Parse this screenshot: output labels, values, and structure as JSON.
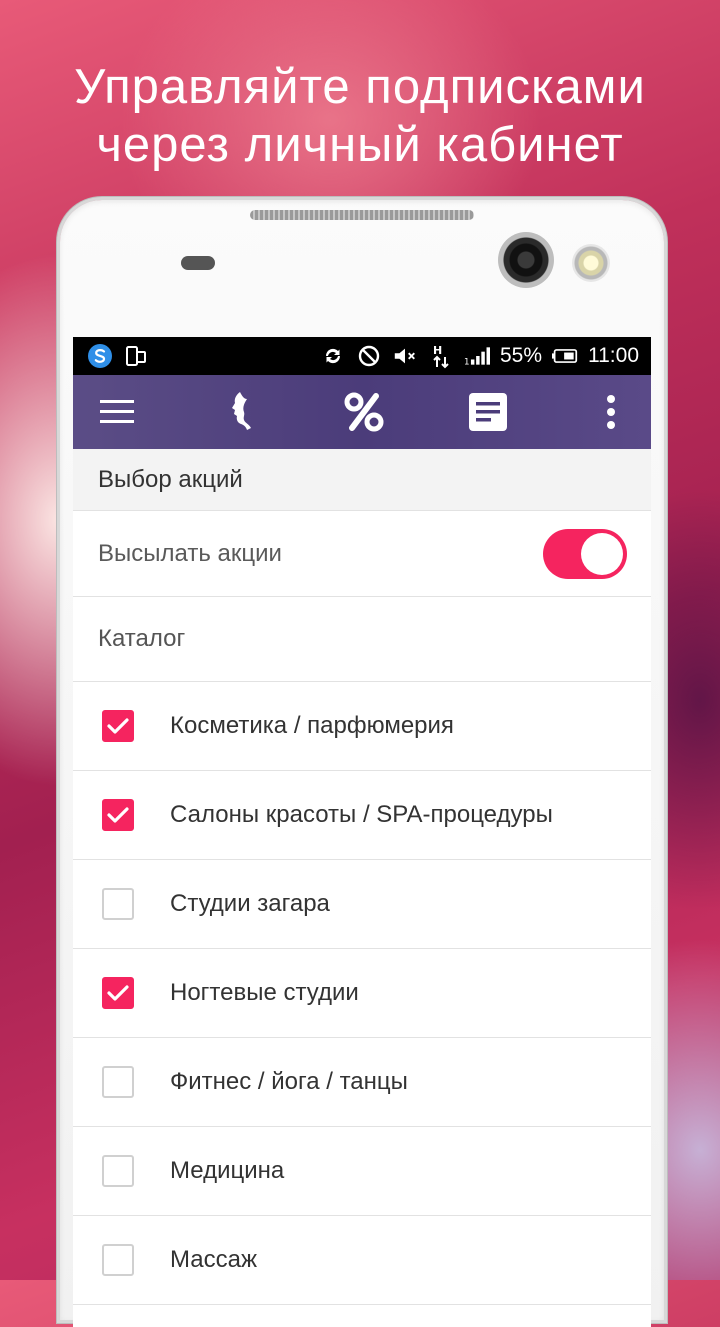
{
  "headline": {
    "line1": "Управляйте подписками",
    "line2": "через личный кабинет"
  },
  "status_bar": {
    "battery": "55%",
    "time": "11:00",
    "icons": [
      "swype-icon",
      "screen-icon",
      "sync-icon",
      "do-not-disturb-icon",
      "mute-icon",
      "data-transfer-icon",
      "signal-icon",
      "battery-icon"
    ]
  },
  "toolbar": {
    "icons": [
      "menu-icon",
      "woman-profile-icon",
      "percent-icon",
      "document-icon",
      "more-icon"
    ]
  },
  "promo_section": {
    "header": "Выбор акций",
    "send_promos_label": "Высылать акции",
    "send_promos_enabled": true,
    "catalog_label": "Каталог"
  },
  "catalog": [
    {
      "label": "Косметика / парфюмерия",
      "checked": true
    },
    {
      "label": "Салоны красоты / SPA-процедуры",
      "checked": true
    },
    {
      "label": "Студии загара",
      "checked": false
    },
    {
      "label": "Ногтевые студии",
      "checked": true
    },
    {
      "label": "Фитнес / йога / танцы",
      "checked": false
    },
    {
      "label": "Медицина",
      "checked": false
    },
    {
      "label": "Массаж",
      "checked": false
    }
  ],
  "colors": {
    "accent": "#f5245f",
    "toolbar": "#4b3c7a"
  }
}
